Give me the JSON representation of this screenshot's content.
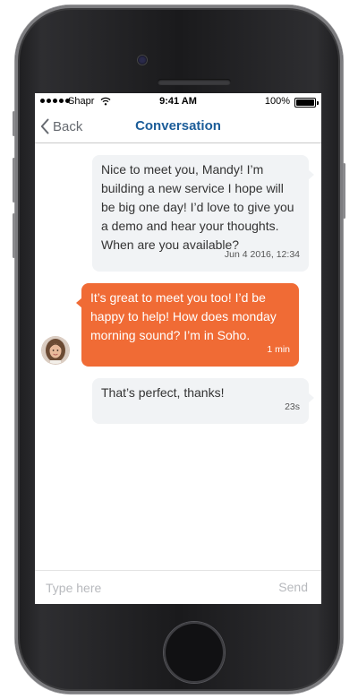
{
  "status_bar": {
    "carrier": "Shapr",
    "time": "9:41 AM",
    "battery": "100%"
  },
  "nav": {
    "back_label": "Back",
    "title": "Conversation"
  },
  "messages": [
    {
      "direction": "outgoing",
      "text": "Nice to meet you, Mandy! I’m building a new service I hope will be big one day! I’d love to give you a demo and hear your thoughts. When are you available?",
      "time": "Jun 4 2016, 12:34"
    },
    {
      "direction": "incoming",
      "text": "It’s great to meet you too! I’d be happy to help! How does monday morning sound? I’m in Soho.",
      "time": "1 min"
    },
    {
      "direction": "outgoing",
      "text": "That’s perfect, thanks!",
      "time": "23s"
    }
  ],
  "composer": {
    "placeholder": "Type here",
    "value": "",
    "send_label": "Send"
  },
  "colors": {
    "accent_blue": "#1c5d99",
    "incoming_bubble": "#f06b35",
    "outgoing_bubble": "#f1f3f5"
  },
  "icons": {
    "back": "chevron-left-icon",
    "wifi": "wifi-icon",
    "battery": "battery-icon",
    "signal": "signal-dots-icon"
  }
}
